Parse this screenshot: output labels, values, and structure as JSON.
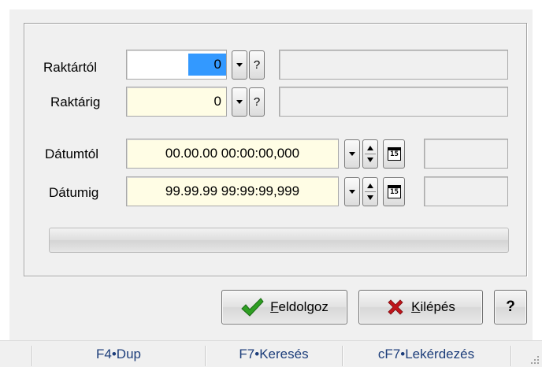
{
  "form": {
    "raktartol": {
      "label": "Raktártól",
      "value": "0"
    },
    "raktarig": {
      "label": "Raktárig",
      "value": "0"
    },
    "datumtol": {
      "label": "Dátumtól",
      "value": "00.00.00 00:00:00,000"
    },
    "datumig": {
      "label": "Dátumig",
      "value": "99.99.99 99:99:99,999"
    },
    "lookup_label": "?",
    "calendar_label": "15"
  },
  "progress": {
    "value": 0
  },
  "buttons": {
    "feldolgoz": {
      "mnemonic": "F",
      "rest": "eldolgoz"
    },
    "kilepes": {
      "mnemonic": "K",
      "rest": "ilépés"
    },
    "help": "?"
  },
  "statusbar": {
    "items": [
      "F4•Dup",
      "F7•Keresés",
      "cF7•Lekérdezés"
    ]
  },
  "colors": {
    "selection": "#3399ff",
    "field_background": "#fffde5",
    "statusbar_text": "#1c3d7a",
    "check_icon": "#2e9e22",
    "close_icon": "#c0141a"
  },
  "icons": [
    "dropdown-arrow-icon",
    "spin-icon",
    "calendar-icon",
    "checkmark-icon",
    "close-x-icon",
    "size-grip-icon"
  ]
}
